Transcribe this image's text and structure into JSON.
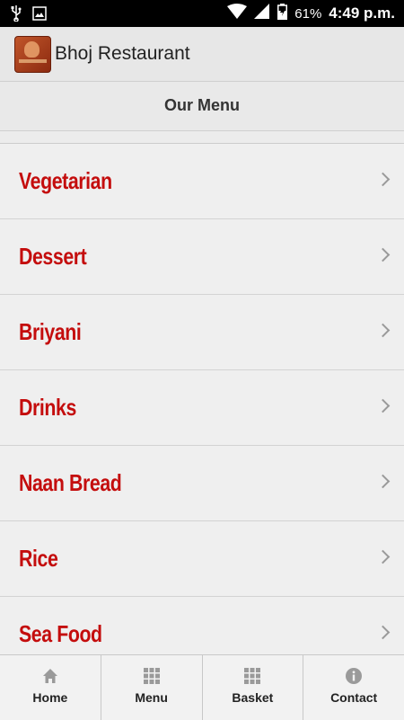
{
  "status_bar": {
    "battery": "61%",
    "time": "4:49 p.m."
  },
  "app_bar": {
    "title": "Bhoj Restaurant"
  },
  "section": {
    "title": "Our Menu"
  },
  "menu": {
    "items": [
      {
        "label": "Vegetarian"
      },
      {
        "label": "Dessert"
      },
      {
        "label": "Briyani"
      },
      {
        "label": "Drinks"
      },
      {
        "label": "Naan Bread"
      },
      {
        "label": "Rice"
      },
      {
        "label": "Sea Food"
      }
    ]
  },
  "bottom_nav": {
    "items": [
      {
        "label": "Home",
        "icon": "home-icon"
      },
      {
        "label": "Menu",
        "icon": "grid-icon"
      },
      {
        "label": "Basket",
        "icon": "grid-icon"
      },
      {
        "label": "Contact",
        "icon": "info-icon"
      }
    ]
  },
  "colors": {
    "item_text": "#c40d0d",
    "background": "#ececec"
  }
}
